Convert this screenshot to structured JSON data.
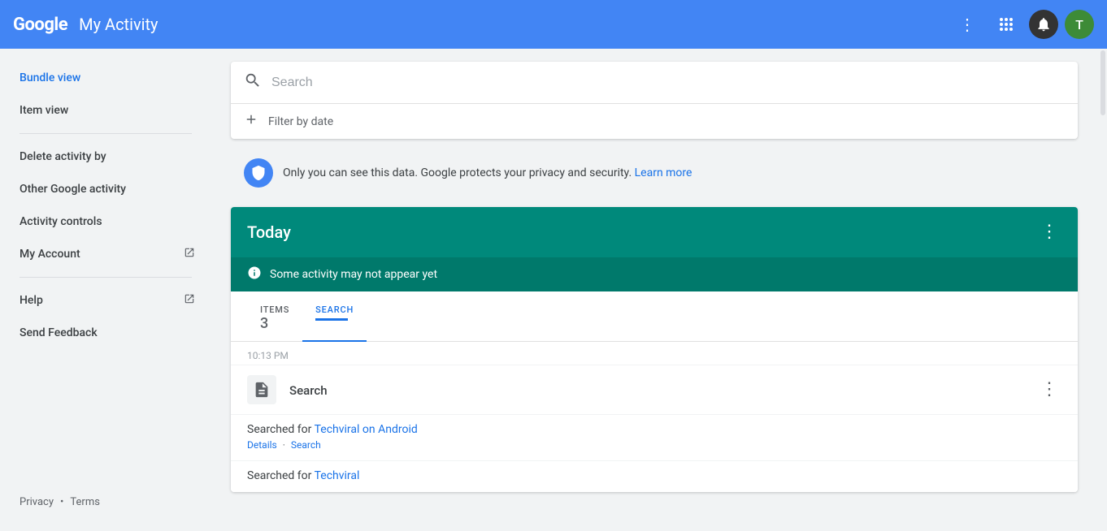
{
  "header": {
    "google_label": "Google",
    "title": "My Activity",
    "more_options_icon": "⋮",
    "apps_icon": "⠿",
    "avatar_letter": "T"
  },
  "sidebar": {
    "items": [
      {
        "id": "bundle-view",
        "label": "Bundle view",
        "active": true,
        "external": false
      },
      {
        "id": "item-view",
        "label": "Item view",
        "active": false,
        "external": false
      }
    ],
    "actions": [
      {
        "id": "delete-activity",
        "label": "Delete activity by",
        "external": false
      },
      {
        "id": "other-google",
        "label": "Other Google activity",
        "external": false
      },
      {
        "id": "activity-controls",
        "label": "Activity controls",
        "external": false
      },
      {
        "id": "my-account",
        "label": "My Account",
        "external": true
      },
      {
        "id": "help",
        "label": "Help",
        "external": true
      },
      {
        "id": "send-feedback",
        "label": "Send Feedback",
        "external": false
      }
    ],
    "footer": {
      "privacy_label": "Privacy",
      "dot": "•",
      "terms_label": "Terms"
    }
  },
  "search": {
    "placeholder": "Search",
    "filter_label": "Filter by date"
  },
  "privacy_notice": {
    "text": "Only you can see this data. Google protects your privacy and security.",
    "link_text": "Learn more"
  },
  "today_section": {
    "title": "Today",
    "menu_icon": "⋮",
    "notice": "Some activity may not appear yet",
    "tabs": [
      {
        "id": "items-tab",
        "label": "ITEMS",
        "value": "3",
        "active": false
      },
      {
        "id": "search-tab",
        "label": "SEARCH",
        "value": "",
        "active": true
      }
    ]
  },
  "activities": [
    {
      "time": "10:13 PM",
      "title": "Search",
      "icon": "📄",
      "items": [
        {
          "text_prefix": "Searched for",
          "link_text": "Techviral on Android",
          "meta_details": "Details",
          "meta_search": "Search"
        },
        {
          "text_prefix": "Searched for",
          "link_text": "Techviral",
          "meta_details": "",
          "meta_search": ""
        }
      ]
    }
  ]
}
